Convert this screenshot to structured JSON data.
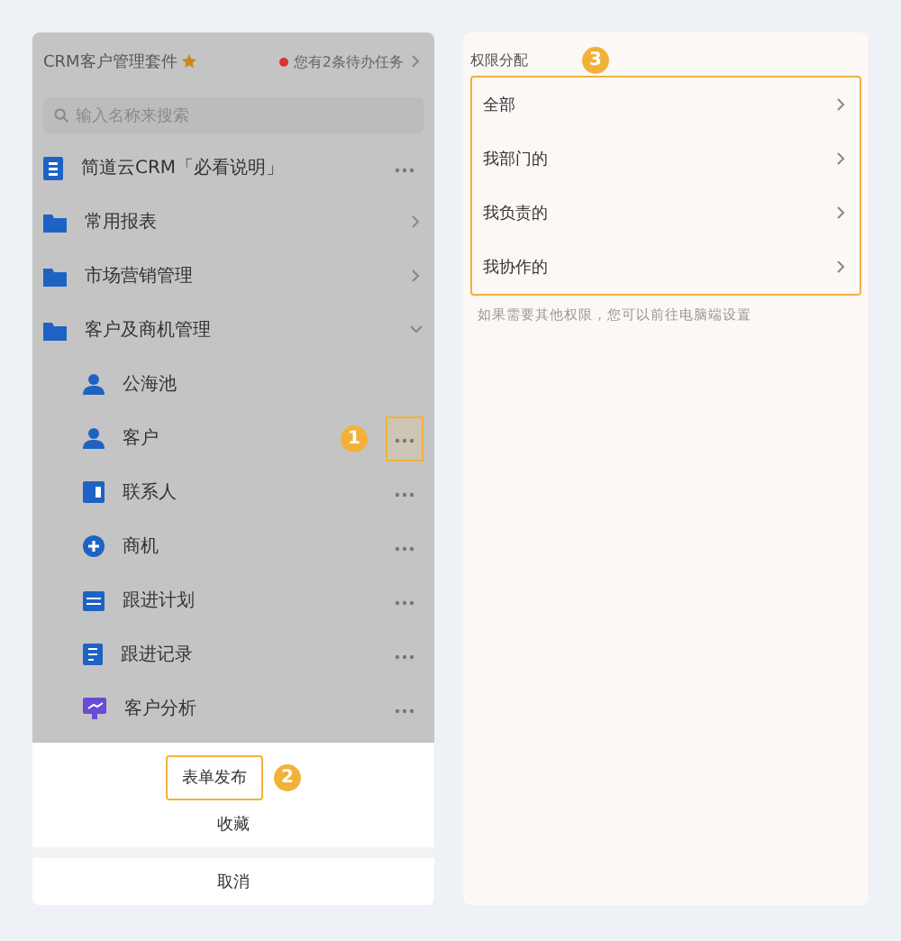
{
  "header": {
    "title": "CRM客户管理套件",
    "todo": "您有2条待办任务"
  },
  "search": {
    "placeholder": "输入名称来搜索"
  },
  "items": [
    {
      "kind": "doc",
      "label": "简道云CRM「必看说明」",
      "more": true,
      "highlighted": false
    },
    {
      "kind": "folder",
      "label": "常用报表",
      "expanded": false
    },
    {
      "kind": "folder",
      "label": "市场营销管理",
      "expanded": false
    },
    {
      "kind": "folder",
      "label": "客户及商机管理",
      "expanded": true,
      "children": [
        {
          "kind": "pool",
          "label": "公海池",
          "more": false
        },
        {
          "kind": "person",
          "label": "客户",
          "more": true,
          "highlighted": true,
          "callout": "1"
        },
        {
          "kind": "contact",
          "label": "联系人",
          "more": true,
          "highlighted": false
        },
        {
          "kind": "plus",
          "label": "商机",
          "more": true,
          "highlighted": false
        },
        {
          "kind": "plan",
          "label": "跟进计划",
          "more": true,
          "highlighted": false
        },
        {
          "kind": "record",
          "label": "跟进记录",
          "more": true,
          "highlighted": false
        },
        {
          "kind": "chart",
          "label": "客户分析",
          "more": true,
          "highlighted": false
        }
      ]
    }
  ],
  "sheet": [
    {
      "label": "表单发布",
      "highlighted": true,
      "callout": "2"
    },
    {
      "label": "收藏",
      "highlighted": false
    },
    {
      "label": "取消",
      "highlighted": false
    }
  ],
  "permissions": {
    "title": "权限分配",
    "callout": "3",
    "highlighted": true,
    "options": [
      {
        "label": "全部"
      },
      {
        "label": "我部门的"
      },
      {
        "label": "我负责的"
      },
      {
        "label": "我协作的"
      }
    ],
    "note": "如果需要其他权限，您可以前往电脑端设置"
  }
}
